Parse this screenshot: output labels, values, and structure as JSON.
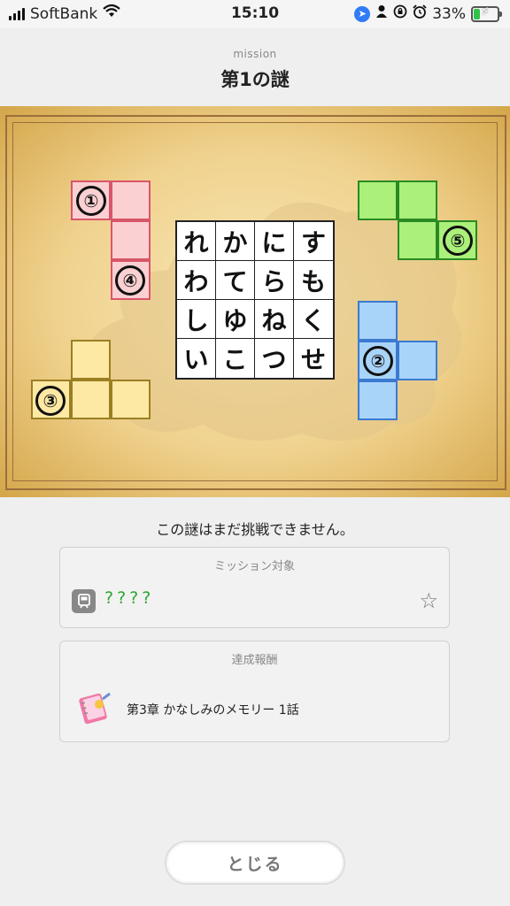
{
  "status_bar": {
    "carrier": "SoftBank",
    "time": "15:10",
    "battery": "33%",
    "battery_level": 0.33
  },
  "header": {
    "label": "mission",
    "title": "第1の謎"
  },
  "puzzle": {
    "grid": [
      [
        "れ",
        "か",
        "に",
        "す"
      ],
      [
        "わ",
        "て",
        "ら",
        "も"
      ],
      [
        "し",
        "ゆ",
        "ね",
        "く"
      ],
      [
        "い",
        "こ",
        "つ",
        "せ"
      ]
    ],
    "piece_numbers": [
      "①",
      "④",
      "⑤",
      "③",
      "②"
    ]
  },
  "message": "この謎はまだ挑戦できません。",
  "mission_target": {
    "title": "ミッション対象",
    "value": "????"
  },
  "reward": {
    "title": "達成報酬",
    "text": "第3章 かなしみのメモリー 1話"
  },
  "close_button": "とじる",
  "colors": {
    "pink": "#fad0d2",
    "green": "#aaf07a",
    "yellow": "#fde9a4",
    "blue": "#a9d4fa",
    "target_green": "#2ba832"
  }
}
